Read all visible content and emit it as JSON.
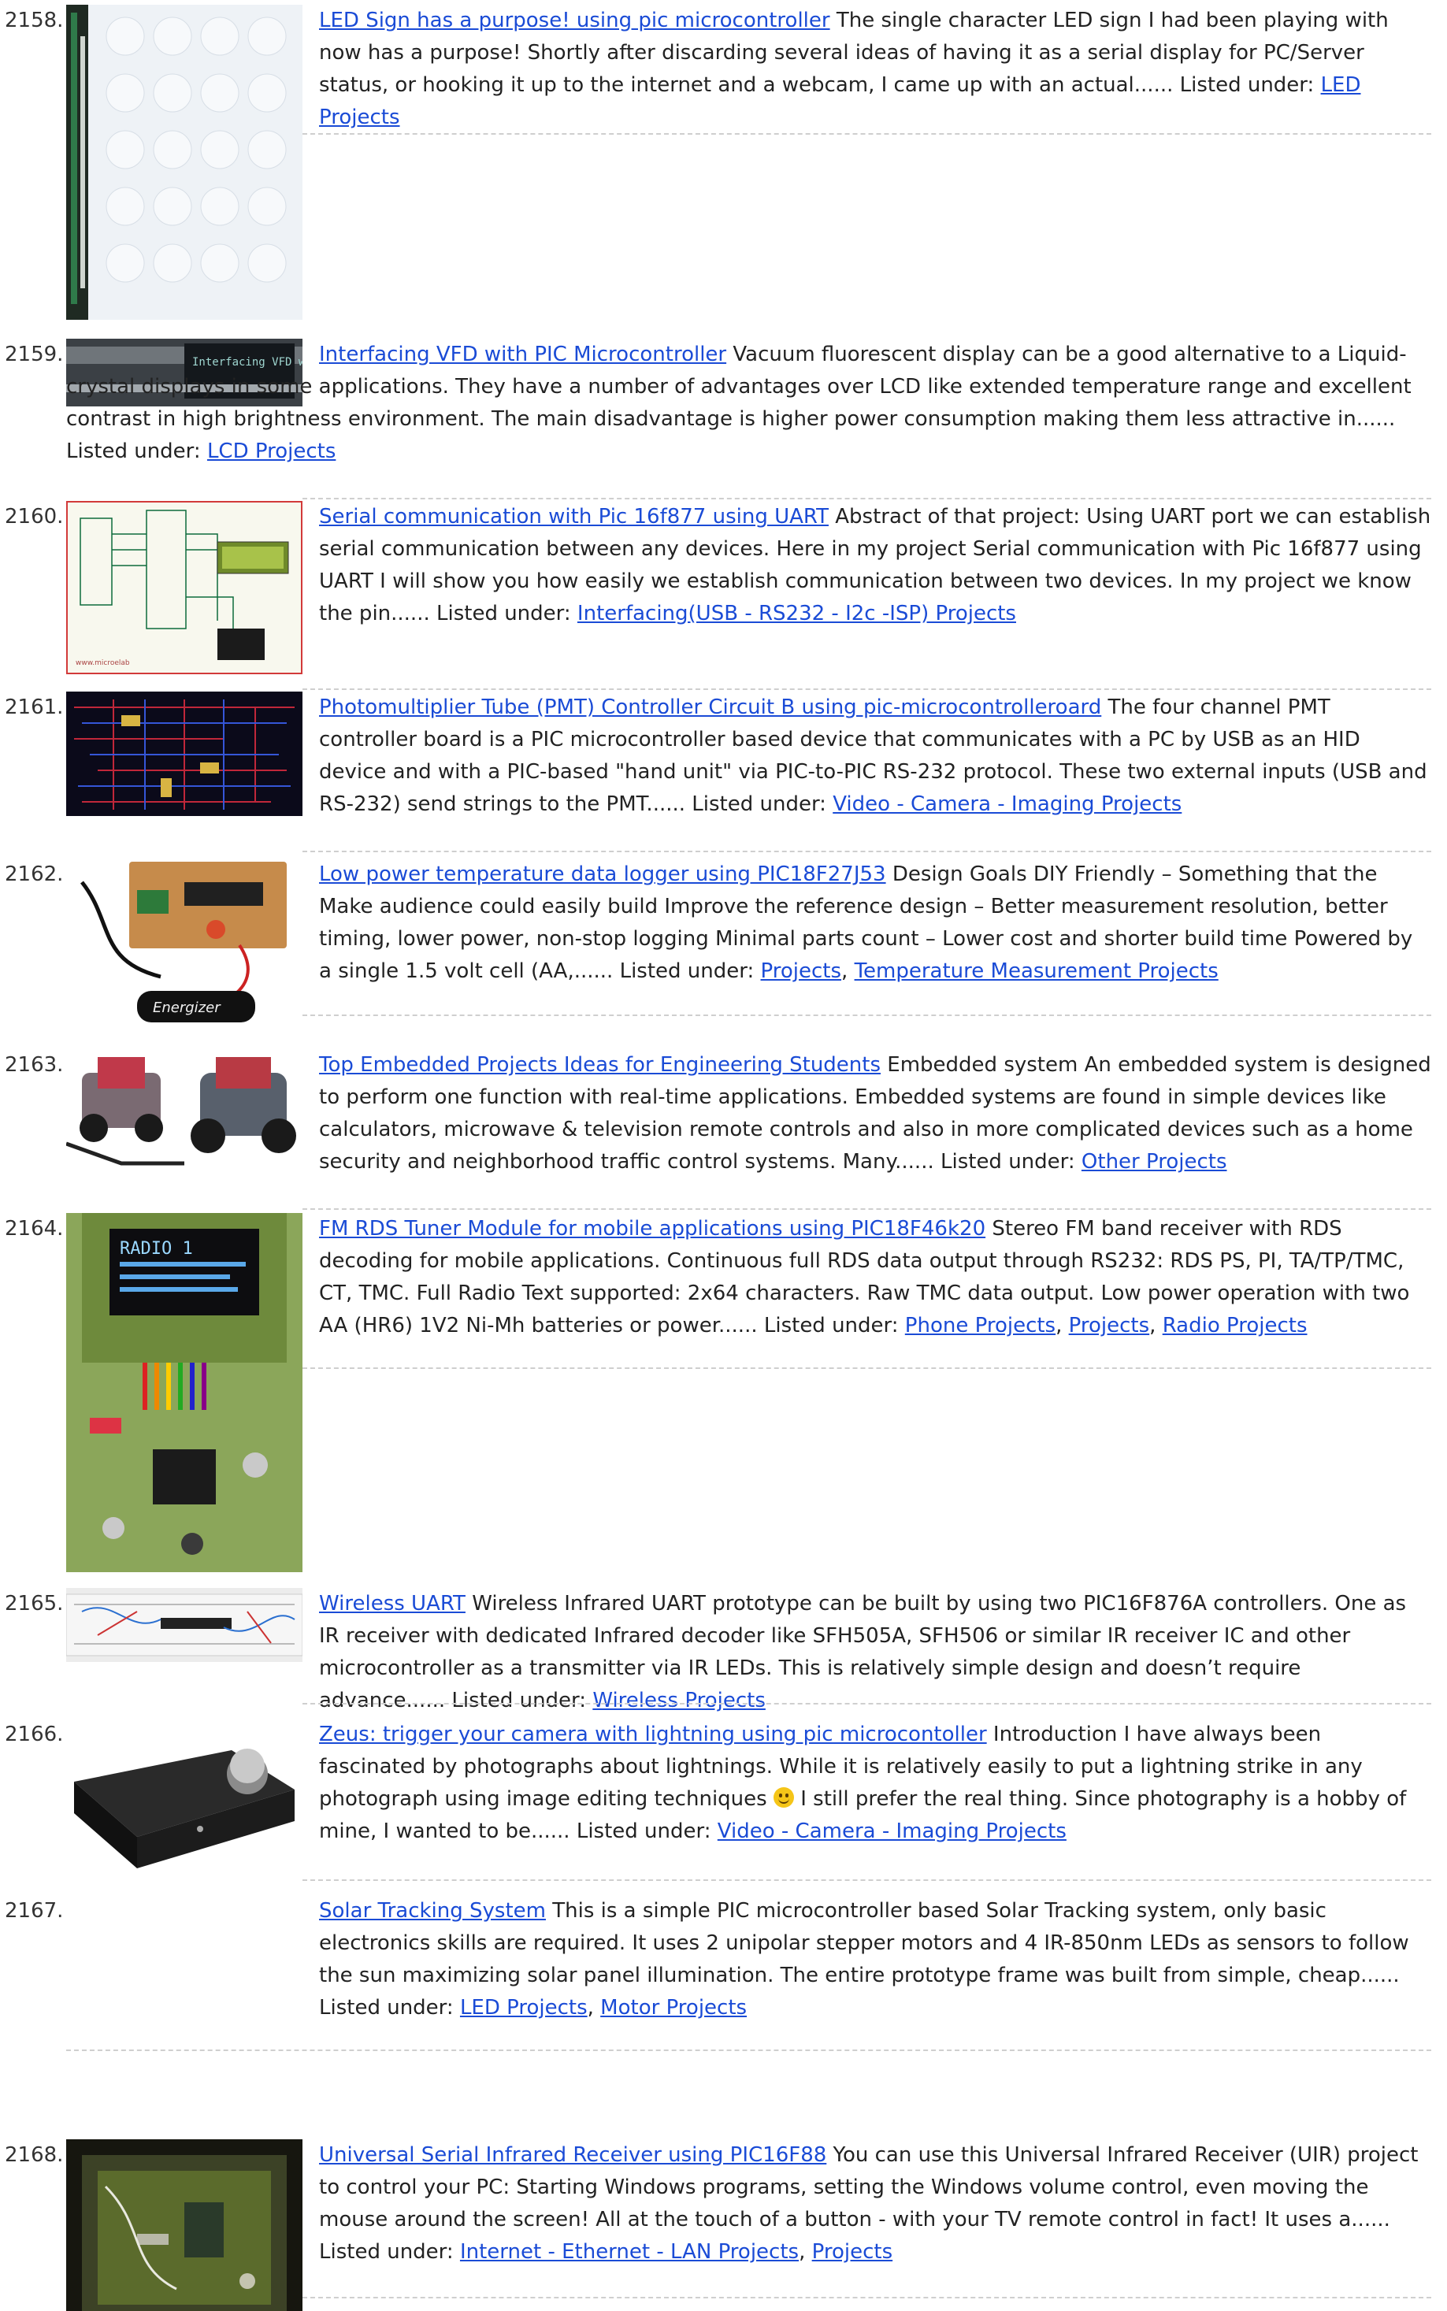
{
  "entries": [
    {
      "num": "2158.",
      "title": "LED Sign has a purpose! using pic microcontroller",
      "desc": " The single character LED sign I had been playing with now has a purpose! Shortly after discarding several ideas of having it as a serial display for PC/Server status, or hooking it up to the internet and a webcam, I came up with an actual...... Listed under: ",
      "cats": [
        "LED Projects"
      ],
      "img": "led-matrix-photo"
    },
    {
      "num": "2159.",
      "title": "Interfacing VFD with PIC Microcontroller",
      "desc": " Vacuum fluorescent display can be a good alternative to a Liquid-crystal displays in some applications. They have a number of advantages over LCD like extended temperature range and excellent contrast in high brightness environment. The main disadvantage is higher power consumption making them less attractive in...... Listed under: ",
      "cats": [
        "LCD Projects"
      ],
      "img": "vfd-display-photo",
      "img_text": "Interfacing VFD with PIC"
    },
    {
      "num": "2160.",
      "title": "Serial communication with Pic 16f877 using UART",
      "desc": " Abstract of that project: Using UART port we can establish serial communication between any devices. Here in my project Serial communication with Pic 16f877 using UART I will show you how easily we establish communication between two devices. In my project we know the pin...... Listed under: ",
      "cats": [
        "Interfacing(USB - RS232 - I2c -ISP) Projects"
      ],
      "img": "proteus-schematic"
    },
    {
      "num": "2161.",
      "title": "Photomultiplier Tube (PMT) Controller Circuit B using pic-microcontrolleroard",
      "desc": " The four channel PMT controller board is a PIC microcontroller based device that communicates with a PC by USB as an HID device and with a PIC-based \"hand unit\" via PIC-to-PIC RS-232 protocol. These two external inputs (USB and RS-232) send strings to the PMT...... Listed under: ",
      "cats": [
        "Video - Camera - Imaging Projects"
      ],
      "img": "pcb-layout"
    },
    {
      "num": "2162.",
      "title": "Low power temperature data logger using PIC18F27J53",
      "desc": " Design Goals DIY Friendly – Something that the Make audience could easily build Improve the reference design – Better measurement resolution, better timing, lower power, non-stop logging Minimal parts count – Lower cost and shorter build time Powered by a single 1.5 volt cell (AA,...... Listed under: ",
      "cats": [
        "Projects",
        "Temperature Measurement Projects"
      ],
      "img": "data-logger-board",
      "img_text": "Energizer"
    },
    {
      "num": "2163.",
      "title": "Top Embedded Projects Ideas for Engineering Students",
      "desc": " Embedded system An embedded system is designed to perform one function with real-time applications. Embedded systems are found in simple devices like calculators, microwave & television remote controls and also in more complicated devices such as a home security and neighborhood traffic control systems. Many...... Listed under: ",
      "cats": [
        "Other Projects"
      ],
      "img": "robot-cars"
    },
    {
      "num": "2164.",
      "title": "FM RDS Tuner Module for mobile applications using PIC18F46k20",
      "desc": " Stereo FM band receiver with RDS decoding for mobile applications. Continuous full RDS data output through RS232: RDS PS, PI, TA/TP/TMC, CT, TMC. Full Radio Text supported: 2x64 characters. Raw TMC data output. Low power operation with two AA (HR6) 1V2 Ni-Mh batteries or power...... Listed under: ",
      "cats": [
        "Phone Projects",
        "Projects",
        "Radio Projects"
      ],
      "img": "fm-rds-board",
      "img_text": "RADIO 1"
    },
    {
      "num": "2165.",
      "title": "Wireless UART",
      "desc": " Wireless Infrared UART prototype can be built by using two PIC16F876A controllers. One as IR receiver with dedicated Infrared decoder like SFH505A, SFH506 or similar IR receiver IC and other microcontroller as a transmitter via IR LEDs. This is relatively simple design and doesn’t require advance...... Listed under: ",
      "cats": [
        "Wireless Projects"
      ],
      "img": "breadboard"
    },
    {
      "num": "2166.",
      "title": "Zeus: trigger your camera with lightning using pic microcontoller",
      "desc_a": " Introduction I have always been fascinated by photographs about lightnings. While it is relatively easily to put a lightning strike in any photograph using image editing techniques ",
      "desc_b": " I still prefer the real thing. Since photography is a hobby of mine, I wanted to be...... Listed under: ",
      "cats": [
        "Video - Camera - Imaging Projects"
      ],
      "img": "black-enclosure"
    },
    {
      "num": "2167.",
      "title": "Solar Tracking System",
      "desc": " This is a simple PIC microcontroller based Solar Tracking system, only basic electronics skills are required. It uses 2 unipolar stepper motors and 4 IR-850nm LEDs as sensors to follow the sun  maximizing solar panel illumination. The entire prototype frame was built from simple, cheap...... Listed under: ",
      "cats": [
        "LED Projects",
        "Motor Projects"
      ]
    },
    {
      "num": "2168.",
      "title": "Universal Serial Infrared Receiver using PIC16F88",
      "desc": " You can use this Universal Infrared Receiver (UIR) project to control your PC:  Starting Windows programs,  setting the Windows volume control,  even moving the mouse around the screen! All at the touch of a button - with your TV remote control in fact! It uses a...... Listed under: ",
      "cats": [
        "Internet - Ethernet - LAN Projects",
        "Projects"
      ],
      "img": "ir-receiver-box"
    }
  ],
  "cat_sep": ", ",
  "icons": {
    "smiley": "smiley-emoji-icon"
  }
}
